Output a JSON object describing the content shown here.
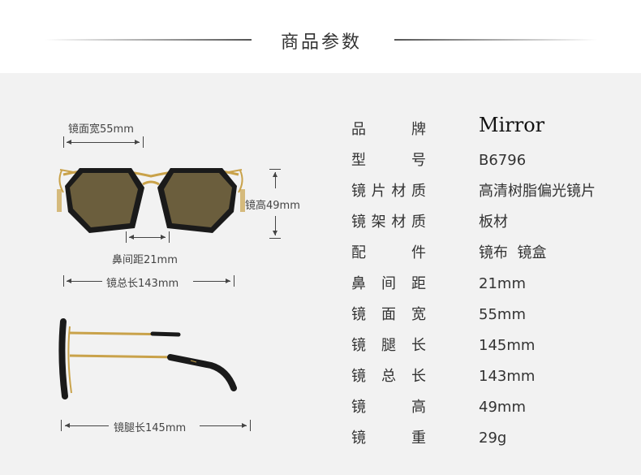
{
  "header": {
    "title": "商品参数"
  },
  "dimensions": {
    "lens_width": "镜面宽55mm",
    "lens_height": "镜高49mm",
    "bridge": "鼻间距21mm",
    "total_length": "镜总长143mm",
    "temple_length": "镜腿长145mm"
  },
  "specs": [
    {
      "label": "品牌",
      "value": "Mirror"
    },
    {
      "label": "型号",
      "value": "B6796"
    },
    {
      "label": "镜片材质",
      "value": "高清树脂偏光镜片"
    },
    {
      "label": "镜架材质",
      "value": "板材"
    },
    {
      "label": "配件",
      "value": "镜布  镜盒"
    },
    {
      "label": "鼻间距",
      "value": "21mm"
    },
    {
      "label": "镜面宽",
      "value": "55mm"
    },
    {
      "label": "镜腿长",
      "value": "145mm"
    },
    {
      "label": "镜总长",
      "value": "143mm"
    },
    {
      "label": "镜高",
      "value": "49mm"
    },
    {
      "label": "镜重",
      "value": "29g"
    }
  ],
  "colors": {
    "panel": "#f2f2f2",
    "frame": "#1a1a1a",
    "lens": "#6b5e3d",
    "metal": "#c9a24a"
  }
}
